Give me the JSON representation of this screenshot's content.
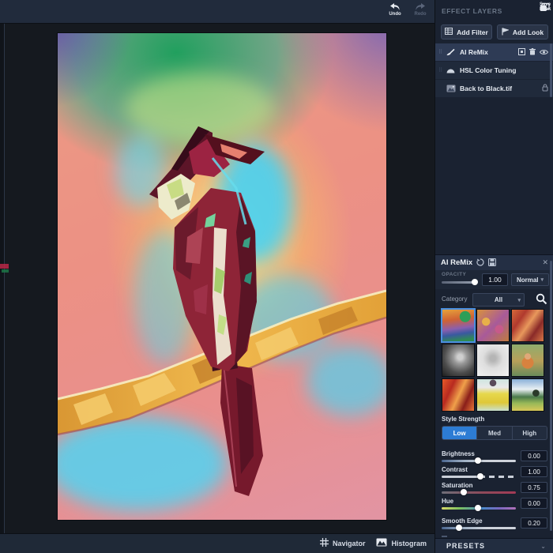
{
  "top_bar": {
    "undo_label": "Undo",
    "redo_label": "Redo"
  },
  "panel": {
    "header_title": "EFFECT LAYERS",
    "save_look_label": "Save Look",
    "add_filter_label": "Add Filter",
    "add_look_label": "Add Look",
    "layers": [
      {
        "label": "AI ReMix",
        "selected": true
      },
      {
        "label": "HSL Color Tuning",
        "selected": false
      },
      {
        "label": "Back to Black.tif",
        "selected": false,
        "locked": true
      }
    ],
    "filter": {
      "title": "AI ReMix",
      "close_glyph": "✕",
      "opacity_label": "OPACITY",
      "opacity_value": "1.00",
      "blend_mode": "Normal",
      "category_label": "Category",
      "category_value": "All",
      "presets_grid": {
        "count": 9,
        "selected_index": 0
      },
      "style_strength_label": "Style Strength",
      "style_options": [
        {
          "label": "Low",
          "active": true
        },
        {
          "label": "Med",
          "active": false
        },
        {
          "label": "High",
          "active": false
        }
      ],
      "sliders": [
        {
          "label": "Brightness",
          "value": "0.00"
        },
        {
          "label": "Contrast",
          "value": "1.00"
        },
        {
          "label": "Saturation",
          "value": "0.75"
        },
        {
          "label": "Hue",
          "value": "0.00"
        },
        {
          "label": "Smooth Edge",
          "value": "0.20"
        }
      ],
      "presets_section_label": "PRESETS"
    }
  },
  "bottom_bar": {
    "navigator_label": "Navigator",
    "histogram_label": "Histogram"
  },
  "colors": {
    "accent_blue": "#2d7cd4",
    "panel_bg": "#1a2231",
    "selected_row_bg": "#2e3b55",
    "topbar_bg": "#212b3c"
  }
}
